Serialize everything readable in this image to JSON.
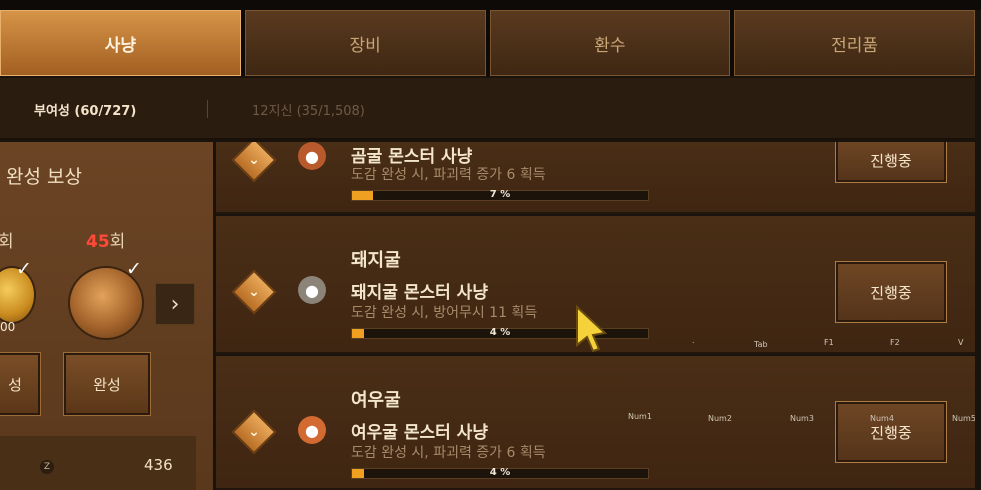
{
  "tabs": [
    {
      "label": "사냥",
      "active": true
    },
    {
      "label": "장비",
      "active": false
    },
    {
      "label": "환수",
      "active": false
    },
    {
      "label": "전리품",
      "active": false
    }
  ],
  "subtabs": {
    "active": "부여성 (60/727)",
    "inactive": "12지신 (35/1,508)"
  },
  "reward_panel": {
    "title": "완성 보상",
    "count_left_suffix": "회",
    "count_right_value": "45",
    "count_right_suffix": "회",
    "coin_amount_fragment": "00",
    "done_label_partial": "성",
    "done_label": "완성",
    "next_icon": "chevron-right-icon",
    "check_icon": "checkmark-icon",
    "stat_key": "Z",
    "stat_value": "436"
  },
  "quests": [
    {
      "cave": "",
      "title": "곰굴 몬스터 사냥",
      "desc": "도감 완성 시, 파괴력 증가 6 획득",
      "progress_pct": 7,
      "progress_label": "7 %",
      "button": "진행중",
      "icon": "bear-icon"
    },
    {
      "cave": "돼지굴",
      "title": "돼지굴 몬스터 사냥",
      "desc": "도감 완성 시, 방어무시 11 획득",
      "progress_pct": 4,
      "progress_label": "4 %",
      "button": "진행중",
      "icon": "boar-icon"
    },
    {
      "cave": "여우굴",
      "title": "여우굴 몬스터 사냥",
      "desc": "도감 완성 시, 파괴력 증가 6 획득",
      "progress_pct": 4,
      "progress_label": "4 %",
      "button": "진행중",
      "icon": "fox-icon"
    }
  ],
  "hotkeys_row1": [
    ".",
    "Tab",
    "F1",
    "F2",
    "V"
  ],
  "hotkeys_row2": [
    "Num1",
    "Num2",
    "Num3",
    "Num4",
    "Num5"
  ],
  "colors": {
    "accent": "#d69448",
    "progress": "#f0a020",
    "count_red": "#ff4a3a"
  }
}
